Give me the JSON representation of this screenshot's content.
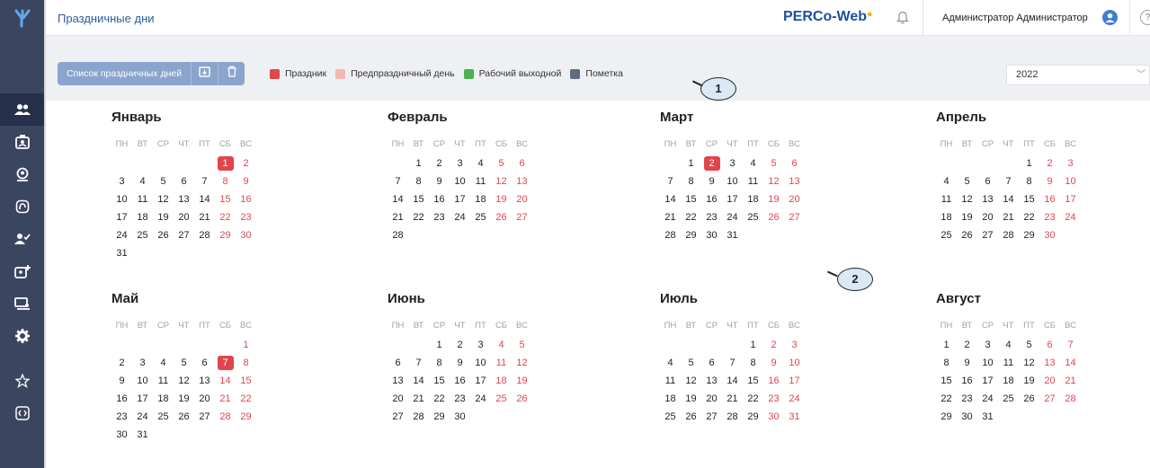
{
  "header": {
    "title": "Праздничные дни",
    "brand": "PERCo-Web",
    "user": "Администратор Администратор",
    "help": "?"
  },
  "toolbar": {
    "list_button": "Список праздничных дней",
    "legend": [
      {
        "label": "Праздник",
        "color": "#e0454b"
      },
      {
        "label": "Предпраздничный день",
        "color": "#f6b7b4"
      },
      {
        "label": "Рабочий выходной",
        "color": "#4caf50"
      },
      {
        "label": "Пометка",
        "color": "#5f6b7e"
      }
    ],
    "year": "2022"
  },
  "sidebar": {
    "items": [
      "users-icon",
      "badge-icon",
      "face-icon",
      "access-icon",
      "user-check-icon",
      "add-badge-icon",
      "monitor-icon",
      "gear-icon",
      "star-icon",
      "code-icon"
    ]
  },
  "calendar": {
    "weekdays": [
      "ПН",
      "ВТ",
      "СР",
      "ЧТ",
      "ПТ",
      "СБ",
      "ВС"
    ],
    "months": [
      {
        "name": "Январь",
        "offset": 5,
        "days": 31,
        "holidays": [
          1
        ]
      },
      {
        "name": "Февраль",
        "offset": 1,
        "days": 28,
        "holidays": []
      },
      {
        "name": "Март",
        "offset": 1,
        "days": 31,
        "holidays": [
          2
        ]
      },
      {
        "name": "Апрель",
        "offset": 4,
        "days": 30,
        "holidays": []
      },
      {
        "name": "Май",
        "offset": 6,
        "days": 31,
        "holidays": [
          7
        ]
      },
      {
        "name": "Июнь",
        "offset": 2,
        "days": 30,
        "holidays": []
      },
      {
        "name": "Июль",
        "offset": 4,
        "days": 31,
        "holidays": []
      },
      {
        "name": "Август",
        "offset": 0,
        "days": 31,
        "holidays": []
      }
    ]
  },
  "callouts": [
    "1",
    "2"
  ]
}
